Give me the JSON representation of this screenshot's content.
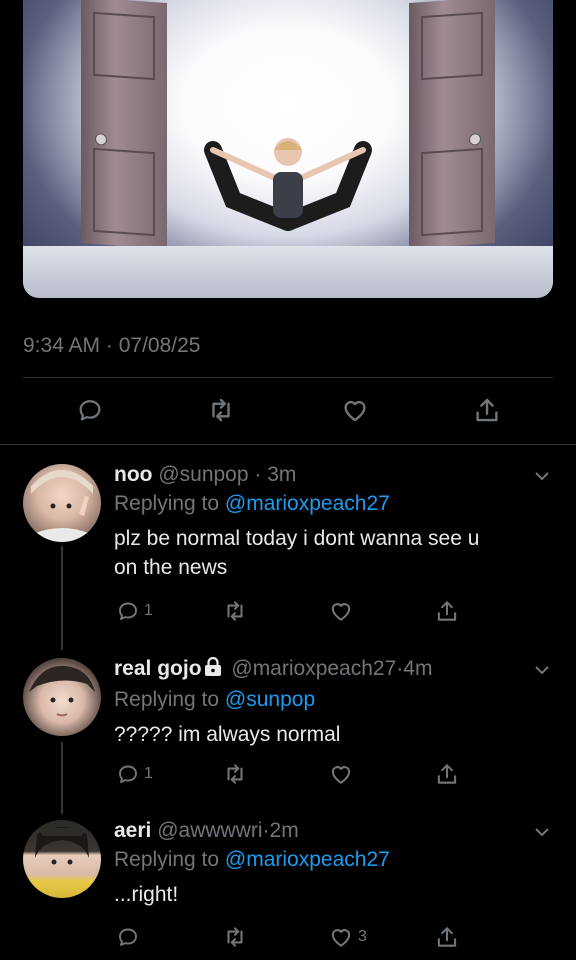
{
  "tweet": {
    "timestamp": "9:34 AM · 07/08/25",
    "media_icon": "image-door-yoga"
  },
  "replies": [
    {
      "display_name": "noo",
      "handle": "@sunpop",
      "time": "3m",
      "replying_prefix": "Replying to",
      "replying_to": "@marioxpeach27",
      "text_line1": "plz be normal today i dont wanna see u",
      "text_line2": "on the news",
      "reply_count": "1",
      "like_count": ""
    },
    {
      "display_name": "real gojo",
      "handle": "@marioxpeach27",
      "time": "4m",
      "replying_prefix": "Replying to",
      "replying_to": "@sunpop",
      "text_line1": "????? im always normal",
      "reply_count": "1",
      "like_count": ""
    },
    {
      "display_name": "aeri",
      "handle": "@awwwwri",
      "time": "2m",
      "replying_prefix": "Replying to",
      "replying_to": "@marioxpeach27",
      "text_line1": "...right!",
      "reply_count": "",
      "like_count": "3"
    }
  ],
  "icons": [
    "reply-icon",
    "retweet-icon",
    "like-icon",
    "share-icon",
    "chevron-down-icon",
    "lock-icon"
  ],
  "colors": {
    "accent": "#1d9bf0",
    "muted": "#71767b",
    "background": "#000000"
  }
}
